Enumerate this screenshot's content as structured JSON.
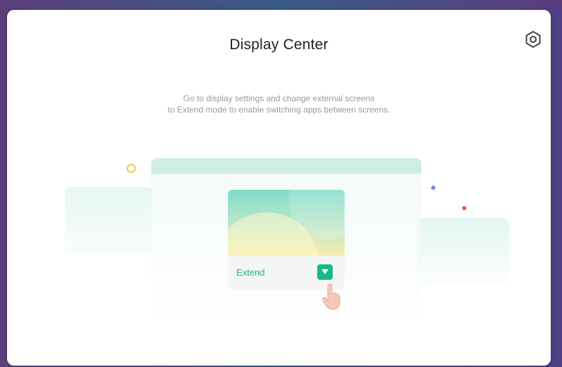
{
  "window": {
    "title": "Display Center",
    "settings_icon": "settings-icon"
  },
  "message": {
    "line1": "Go to display settings and change external screens",
    "line2": "to Extend mode to enable switching apps between screens."
  },
  "illustration": {
    "mode_label": "Extend",
    "dropdown_icon": "caret-down-icon",
    "pointer_icon": "hand-pointer-icon",
    "accent_color": "#17b98a",
    "dot_colors": [
      "#f1c84a",
      "#6e86f2",
      "#f05a3a"
    ]
  }
}
